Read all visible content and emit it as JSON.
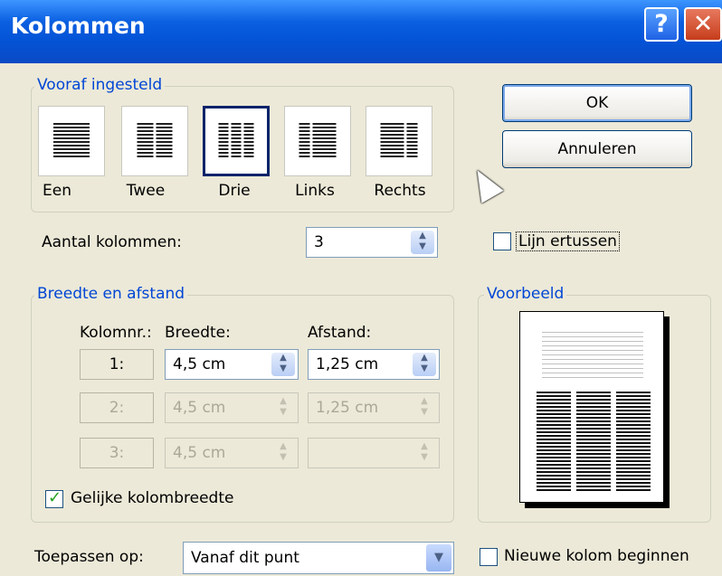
{
  "window": {
    "title": "Kolommen",
    "help_label": "?",
    "close_label": "✕"
  },
  "presets": {
    "group_label": "Vooraf ingesteld",
    "items": [
      {
        "label": "Een",
        "selected": false
      },
      {
        "label": "Twee",
        "selected": false
      },
      {
        "label": "Drie",
        "selected": true
      },
      {
        "label": "Links",
        "selected": false
      },
      {
        "label": "Rechts",
        "selected": false
      }
    ]
  },
  "buttons": {
    "ok": "OK",
    "cancel": "Annuleren"
  },
  "columns_count": {
    "label": "Aantal kolommen:",
    "value": "3"
  },
  "line_between": {
    "label": "Lijn ertussen",
    "checked": false
  },
  "width_spacing": {
    "group_label": "Breedte en afstand",
    "headers": {
      "col": "Kolomnr.:",
      "width": "Breedte:",
      "spacing": "Afstand:"
    },
    "rows": [
      {
        "col": "1:",
        "width": "4,5 cm",
        "spacing": "1,25 cm",
        "enabled": true
      },
      {
        "col": "2:",
        "width": "4,5 cm",
        "spacing": "1,25 cm",
        "enabled": false
      },
      {
        "col": "3:",
        "width": "4,5 cm",
        "spacing": "",
        "enabled": false
      }
    ],
    "equal_width": {
      "label": "Gelijke kolombreedte",
      "checked": true
    }
  },
  "preview": {
    "group_label": "Voorbeeld",
    "columns": 3
  },
  "apply_to": {
    "label": "Toepassen op:",
    "value": "Vanaf dit punt"
  },
  "new_column": {
    "label": "Nieuwe kolom beginnen",
    "checked": false
  },
  "colors": {
    "accent": "#0046d5",
    "title_bar": "#0453d6",
    "dialog_bg": "#ece9d8"
  }
}
